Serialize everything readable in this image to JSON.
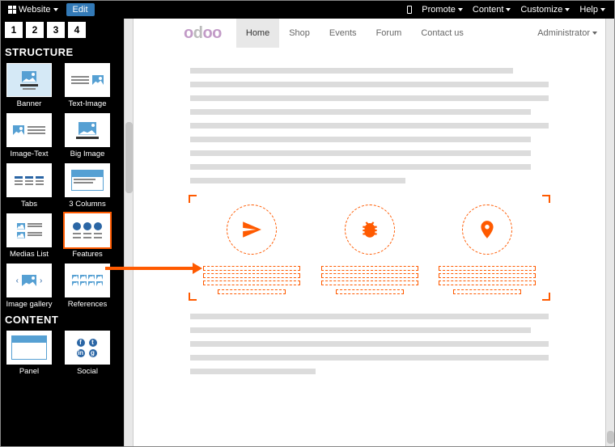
{
  "topbar": {
    "website_label": "Website",
    "edit_label": "Edit",
    "menus": {
      "promote": "Promote",
      "content": "Content",
      "customize": "Customize",
      "help": "Help"
    }
  },
  "pager": [
    "1",
    "2",
    "3",
    "4"
  ],
  "sections": {
    "structure": "STRUCTURE",
    "content": "CONTENT"
  },
  "structure_blocks": [
    {
      "key": "banner",
      "label": "Banner"
    },
    {
      "key": "text-image",
      "label": "Text-Image"
    },
    {
      "key": "image-text",
      "label": "Image-Text"
    },
    {
      "key": "big-image",
      "label": "Big Image"
    },
    {
      "key": "tabs",
      "label": "Tabs"
    },
    {
      "key": "three-columns",
      "label": "3 Columns"
    },
    {
      "key": "medias-list",
      "label": "Medias List"
    },
    {
      "key": "features",
      "label": "Features"
    },
    {
      "key": "image-gallery",
      "label": "Image gallery"
    },
    {
      "key": "references",
      "label": "References"
    }
  ],
  "content_blocks": [
    {
      "key": "panel",
      "label": "Panel"
    },
    {
      "key": "social",
      "label": "Social"
    }
  ],
  "site": {
    "logo_text": "odoo",
    "nav": {
      "home": "Home",
      "shop": "Shop",
      "events": "Events",
      "forum": "Forum",
      "contact": "Contact us"
    },
    "admin_label": "Administrator"
  },
  "feature_icons": [
    "paper-plane-icon",
    "bug-icon",
    "map-pin-icon"
  ]
}
